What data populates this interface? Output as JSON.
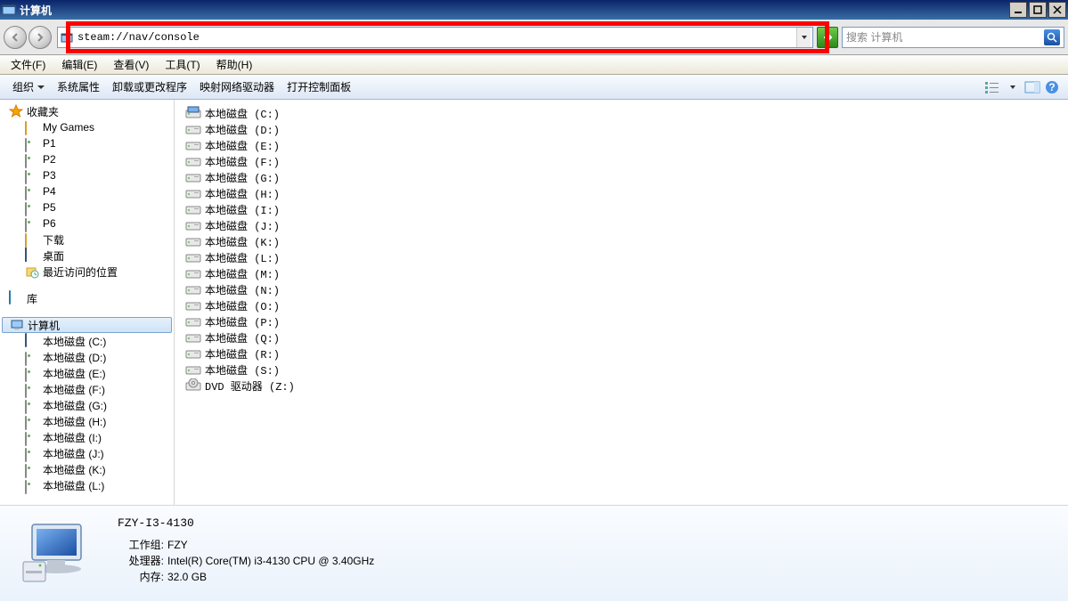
{
  "window": {
    "title": "计算机"
  },
  "address": {
    "value": "steam://nav/console"
  },
  "search": {
    "placeholder": "搜索 计算机"
  },
  "menubar": [
    {
      "label": "文件(F)",
      "key": "file"
    },
    {
      "label": "编辑(E)",
      "key": "edit"
    },
    {
      "label": "查看(V)",
      "key": "view"
    },
    {
      "label": "工具(T)",
      "key": "tools"
    },
    {
      "label": "帮助(H)",
      "key": "help"
    }
  ],
  "toolbar": {
    "organize": "组织",
    "sysprops": "系统属性",
    "uninstall": "卸载或更改程序",
    "mapdrive": "映射网络驱动器",
    "ctrlpanel": "打开控制面板"
  },
  "nav": {
    "favorites": {
      "label": "收藏夹",
      "items": [
        {
          "label": "My Games",
          "icon": "folder"
        },
        {
          "label": "P1",
          "icon": "drive"
        },
        {
          "label": "P2",
          "icon": "drive"
        },
        {
          "label": "P3",
          "icon": "drive"
        },
        {
          "label": "P4",
          "icon": "drive"
        },
        {
          "label": "P5",
          "icon": "drive"
        },
        {
          "label": "P6",
          "icon": "drive"
        },
        {
          "label": "下载",
          "icon": "dl"
        },
        {
          "label": "桌面",
          "icon": "desk"
        },
        {
          "label": "最近访问的位置",
          "icon": "recent"
        }
      ]
    },
    "libraries": {
      "label": "库"
    },
    "computer": {
      "label": "计算机",
      "drives": [
        "本地磁盘 (C:)",
        "本地磁盘 (D:)",
        "本地磁盘 (E:)",
        "本地磁盘 (F:)",
        "本地磁盘 (G:)",
        "本地磁盘 (H:)",
        "本地磁盘 (I:)",
        "本地磁盘 (J:)",
        "本地磁盘 (K:)",
        "本地磁盘 (L:)"
      ]
    }
  },
  "content": {
    "drives": [
      {
        "label": "本地磁盘 (C:)",
        "icon": "winc"
      },
      {
        "label": "本地磁盘 (D:)",
        "icon": "drive"
      },
      {
        "label": "本地磁盘 (E:)",
        "icon": "drive"
      },
      {
        "label": "本地磁盘 (F:)",
        "icon": "drive"
      },
      {
        "label": "本地磁盘 (G:)",
        "icon": "drive"
      },
      {
        "label": "本地磁盘 (H:)",
        "icon": "drive"
      },
      {
        "label": "本地磁盘 (I:)",
        "icon": "drive"
      },
      {
        "label": "本地磁盘 (J:)",
        "icon": "drive"
      },
      {
        "label": "本地磁盘 (K:)",
        "icon": "drive"
      },
      {
        "label": "本地磁盘 (L:)",
        "icon": "drive"
      },
      {
        "label": "本地磁盘 (M:)",
        "icon": "drive"
      },
      {
        "label": "本地磁盘 (N:)",
        "icon": "drive"
      },
      {
        "label": "本地磁盘 (O:)",
        "icon": "drive"
      },
      {
        "label": "本地磁盘 (P:)",
        "icon": "drive"
      },
      {
        "label": "本地磁盘 (Q:)",
        "icon": "drive"
      },
      {
        "label": "本地磁盘 (R:)",
        "icon": "drive"
      },
      {
        "label": "本地磁盘 (S:)",
        "icon": "drive"
      },
      {
        "label": "DVD 驱动器 (Z:)",
        "icon": "dvd"
      }
    ]
  },
  "details": {
    "name": "FZY-I3-4130",
    "rows": [
      {
        "k": "工作组:",
        "v": "FZY"
      },
      {
        "k": "处理器:",
        "v": "Intel(R) Core(TM) i3-4130 CPU @ 3.40GHz"
      },
      {
        "k": "内存:",
        "v": "32.0 GB"
      }
    ]
  }
}
